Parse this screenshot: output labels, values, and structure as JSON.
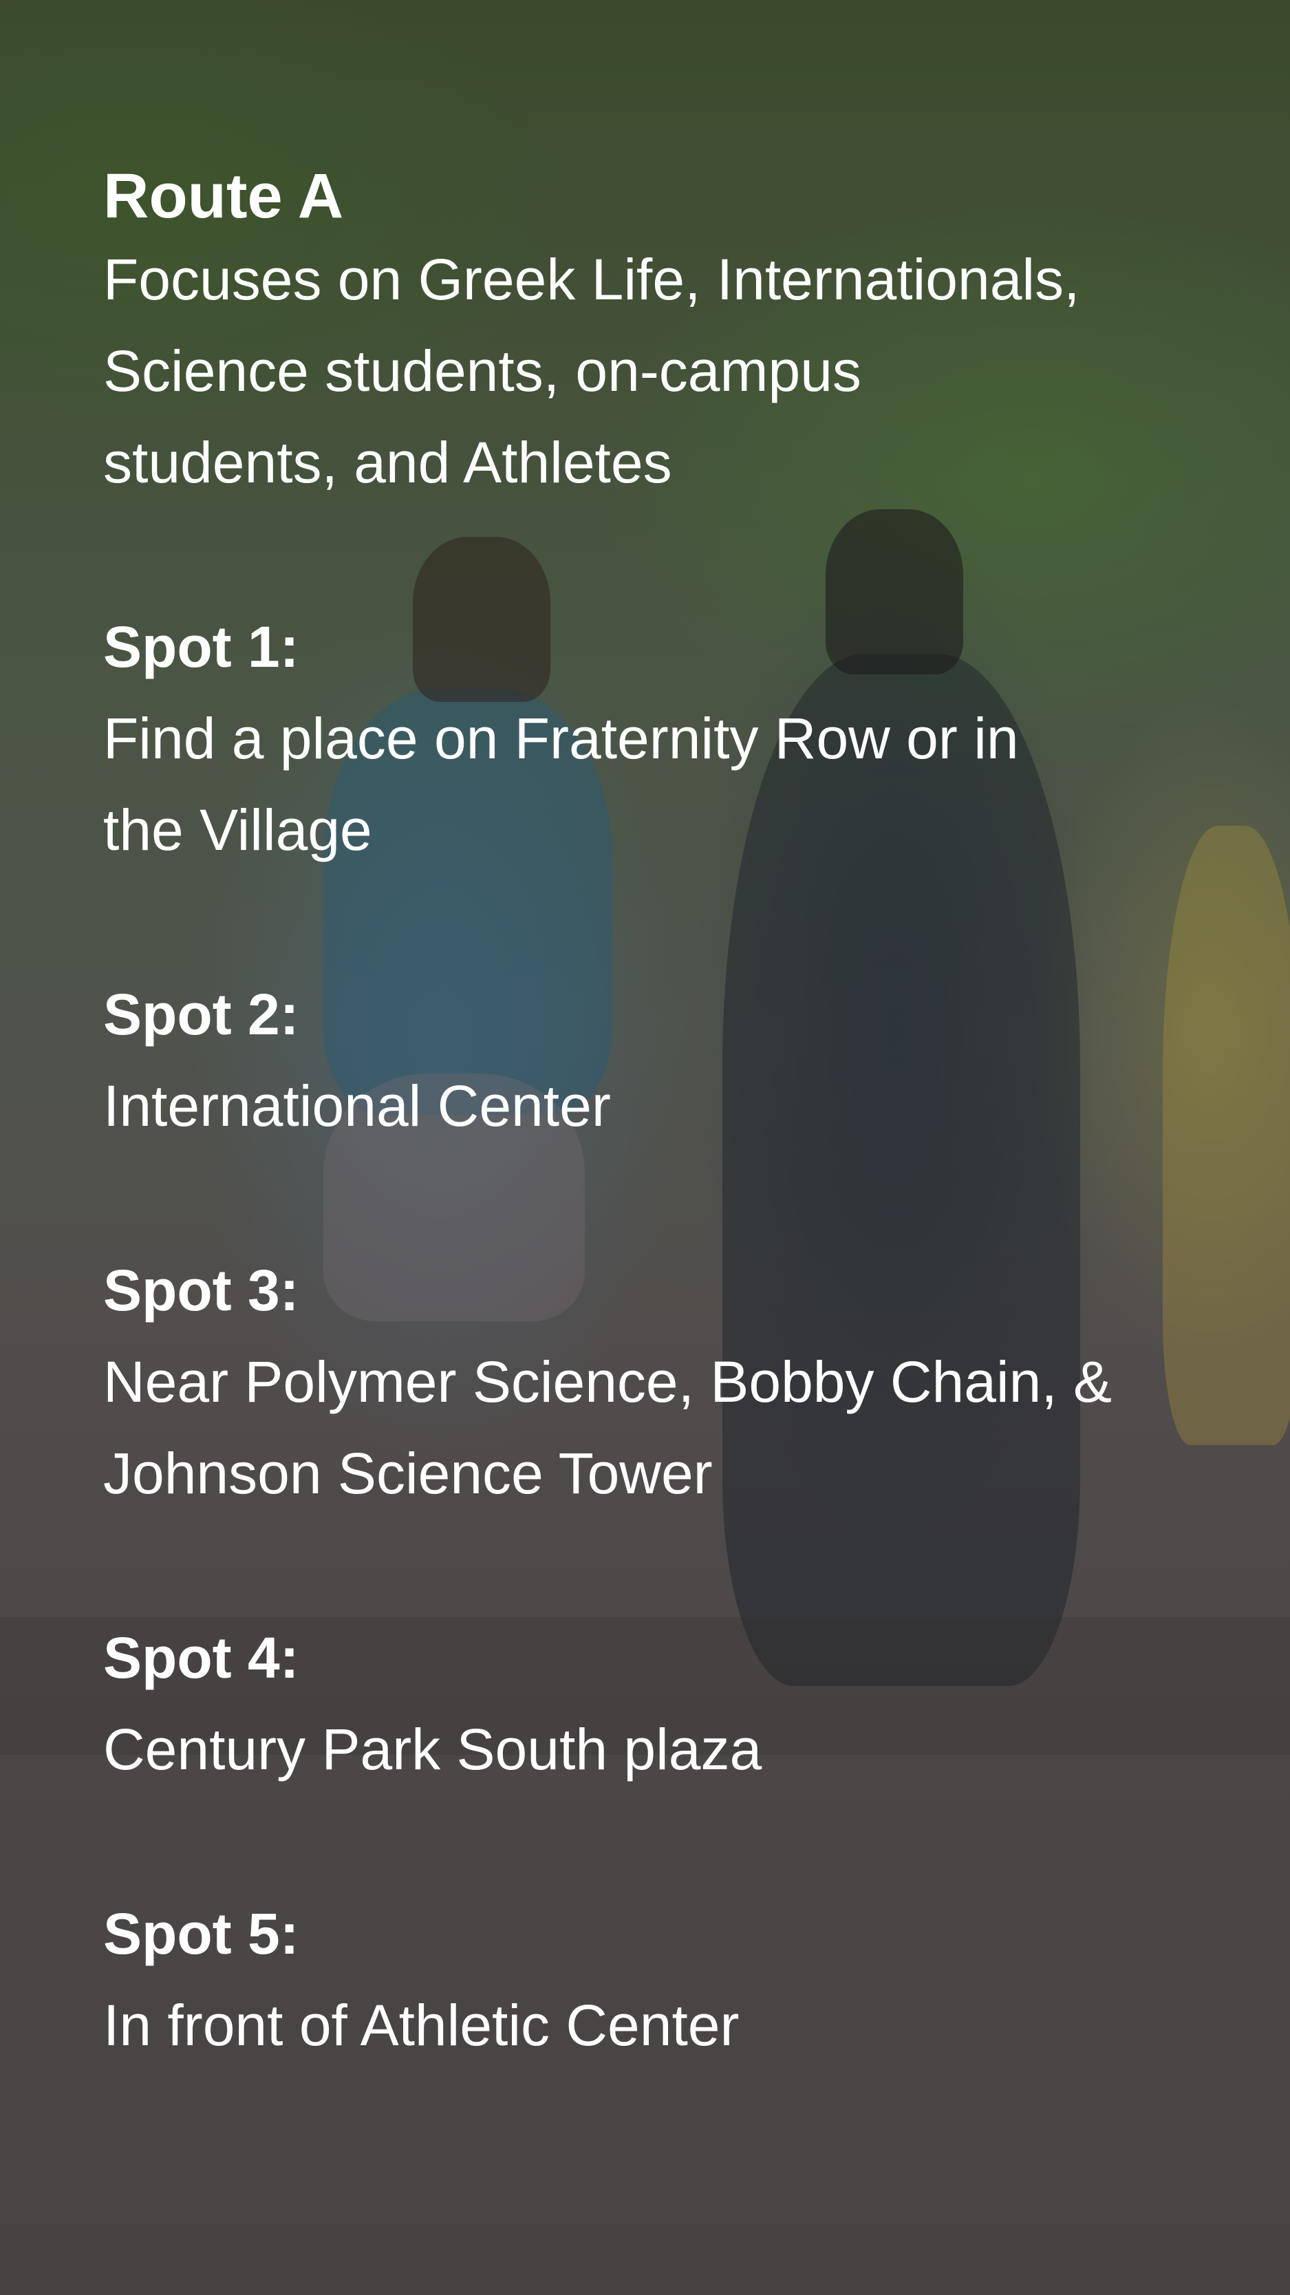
{
  "route": {
    "title": "Route A",
    "description_lines": [
      "Focuses on Greek Life, Internationals,",
      "Science students, on-campus",
      "students, and Athletes"
    ]
  },
  "spots": [
    {
      "label": "Spot 1:",
      "lines": [
        "Find a place on Fraternity Row or in",
        "the Village"
      ]
    },
    {
      "label": "Spot 2:",
      "lines": [
        "International Center"
      ]
    },
    {
      "label": "Spot 3:",
      "lines": [
        "Near Polymer Science, Bobby Chain, &",
        "Johnson Science Tower"
      ]
    },
    {
      "label": "Spot 4:",
      "lines": [
        "Century Park South plaza"
      ]
    },
    {
      "label": "Spot 5:",
      "lines": [
        "In front of Athletic Center"
      ]
    }
  ],
  "colors": {
    "text": "#ffffff",
    "overlay": "#4a4646"
  }
}
